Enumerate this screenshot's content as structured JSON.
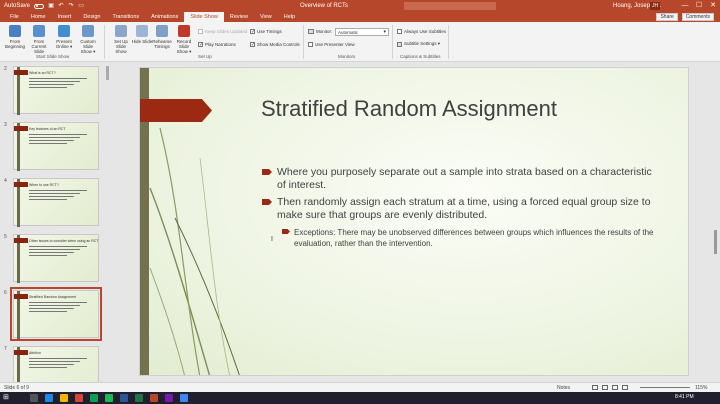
{
  "titlebar": {
    "autosave_label": "AutoSave",
    "doc_title": "Overview of RCTs",
    "user_name": "Hoang, Joseph N.",
    "user_initials": "JH",
    "minimize": "—",
    "maximize": "☐",
    "close": "✕"
  },
  "tabs": [
    "File",
    "Home",
    "Insert",
    "Design",
    "Transitions",
    "Animations",
    "Slide Show",
    "Review",
    "View",
    "Help"
  ],
  "active_tab": "Slide Show",
  "tab_actions": {
    "share": "Share",
    "comments": "Comments"
  },
  "ribbon": {
    "start_group": {
      "label": "Start Slide Show",
      "buttons": [
        "From Beginning",
        "From Current Slide",
        "Present Online ▾",
        "Custom Slide Show ▾"
      ]
    },
    "setup_group": {
      "label": "Set Up",
      "buttons": [
        "Set Up Slide Show",
        "Hide Slide",
        "Rehearse Timings",
        "Record Slide Show ▾"
      ],
      "checks": [
        {
          "label": "Keep Slides Updated",
          "checked": false,
          "disabled": true
        },
        {
          "label": "Play Narrations",
          "checked": true,
          "disabled": false
        },
        {
          "label": "Use Timings",
          "checked": true,
          "disabled": false
        },
        {
          "label": "Show Media Controls",
          "checked": true,
          "disabled": false
        }
      ]
    },
    "monitors_group": {
      "label": "Monitors",
      "monitor_label": "Monitor:",
      "monitor_value": "Automatic",
      "presenter_view": "Use Presenter View"
    },
    "captions_group": {
      "label": "Captions & Subtitles",
      "always_subtitles": "Always Use Subtitles",
      "subtitle_settings": "Subtitle Settings ▾"
    }
  },
  "thumbnails": [
    {
      "num": "2",
      "title": "What is an RCT?"
    },
    {
      "num": "3",
      "title": "Key features of an RCT"
    },
    {
      "num": "4",
      "title": "When to use RCT?"
    },
    {
      "num": "5",
      "title": "Other issues to consider when using an RCT"
    },
    {
      "num": "6",
      "title": "Stratified Random Assignment"
    },
    {
      "num": "7",
      "title": "Attrition"
    }
  ],
  "slide": {
    "title": "Stratified Random Assignment",
    "bullets": [
      "Where you purposely separate out a sample into strata based on a characteristic of interest.",
      "Then randomly assign each stratum at a time, using a forced equal group size to make sure that groups are evenly distributed."
    ],
    "sub_bullet": "Exceptions: There may be unobserved differences between groups which influences the results of the evaluation, rather than the intervention."
  },
  "status": {
    "slide_of": "Slide 6 of 9",
    "notes": "Notes",
    "zoom": "115%"
  },
  "taskbar": {
    "time": "8:41 PM"
  },
  "colors": {
    "accent": "#b7472a",
    "slide_red": "#9c2a13",
    "slide_bar": "#72724e"
  }
}
